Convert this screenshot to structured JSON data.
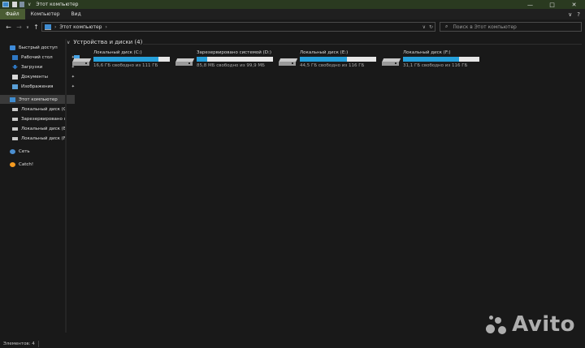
{
  "window": {
    "title": "Этот компьютер",
    "controls": {
      "minimize": "—",
      "maximize": "□",
      "close": "✕"
    }
  },
  "ribbon": {
    "tabs": [
      {
        "label": "Файл",
        "active": true
      },
      {
        "label": "Компьютер",
        "active": false
      },
      {
        "label": "Вид",
        "active": false
      }
    ],
    "expand_icon": "∨",
    "help_icon": "?"
  },
  "navbar": {
    "back": "←",
    "forward": "→",
    "recent": "∨",
    "up": "↑",
    "address_path": "Этот компьютер",
    "search_placeholder": "Поиск в Этот компьютер"
  },
  "sidebar": {
    "items": [
      {
        "label": "Быстрый доступ",
        "icon": "star-icon"
      },
      {
        "label": "Рабочий стол",
        "icon": "desktop-icon",
        "pinned": true
      },
      {
        "label": "Загрузки",
        "icon": "download-icon",
        "pinned": true
      },
      {
        "label": "Документы",
        "icon": "documents-icon",
        "pinned": true
      },
      {
        "label": "Изображения",
        "icon": "pictures-icon",
        "pinned": true
      },
      {
        "label": "Этот компьютер",
        "icon": "computer-icon",
        "selected": true
      },
      {
        "label": "Локальный диск (C",
        "icon": "drive-icon"
      },
      {
        "label": "Зарезервировано с",
        "icon": "drive-icon"
      },
      {
        "label": "Локальный диск (E",
        "icon": "drive-icon"
      },
      {
        "label": "Локальный диск (F",
        "icon": "drive-icon"
      },
      {
        "label": "Сеть",
        "icon": "network-icon"
      },
      {
        "label": "Catch!",
        "icon": "catch-icon"
      }
    ],
    "pin_glyph": "📌"
  },
  "group": {
    "header": "Устройства и диски (4)"
  },
  "drives": [
    {
      "name": "Локальный диск (C:)",
      "free_text": "16,6 ГБ свободно из 111 ГБ",
      "used_fraction": 0.85,
      "system": true
    },
    {
      "name": "Зарезервировано системой (D:)",
      "free_text": "85,8 МБ свободно из 99,9 МБ",
      "used_fraction": 0.14,
      "system": false
    },
    {
      "name": "Локальный диск (E:)",
      "free_text": "44,5 ГБ свободно из 116 ГБ",
      "used_fraction": 0.62,
      "system": false
    },
    {
      "name": "Локальный диск (F:)",
      "free_text": "31,1 ГБ свободно из 116 ГБ",
      "used_fraction": 0.73,
      "system": false
    }
  ],
  "status": {
    "items_count": "Элементов: 4"
  },
  "watermark": {
    "text": "Avito"
  },
  "colors": {
    "accent": "#26a0da",
    "titlebar": "#2a3a20",
    "active_tab": "#4a5c33"
  }
}
